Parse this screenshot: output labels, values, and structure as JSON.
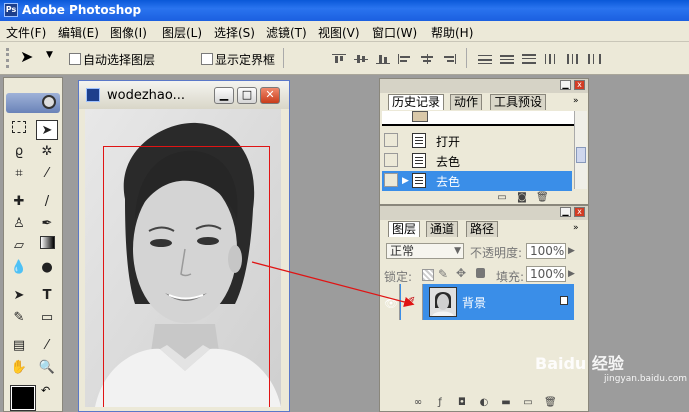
{
  "app": {
    "title": "Adobe Photoshop"
  },
  "menu": [
    "文件(F)",
    "编辑(E)",
    "图像(I)",
    "图层(L)",
    "选择(S)",
    "滤镜(T)",
    "视图(V)",
    "窗口(W)",
    "帮助(H)"
  ],
  "options": {
    "auto_select_label": "自动选择图层",
    "show_bounds_label": "显示定界框"
  },
  "document": {
    "title": "wodezhao..."
  },
  "history_panel": {
    "tabs": [
      "历史记录",
      "动作",
      "工具预设"
    ],
    "items": [
      {
        "label": "打开",
        "selected": false
      },
      {
        "label": "去色",
        "selected": false
      },
      {
        "label": "去色",
        "selected": true
      }
    ]
  },
  "layers_panel": {
    "tabs": [
      "图层",
      "通道",
      "路径"
    ],
    "blend_mode": "正常",
    "opacity_label": "不透明度:",
    "opacity_value": "100%",
    "lock_label": "锁定:",
    "fill_label": "填充:",
    "fill_value": "100%",
    "layer_name": "背景"
  },
  "watermark": {
    "text": "Baidu 经验",
    "sub": "jingyan.baidu.com"
  },
  "colors": {
    "titlebar": "#1b5fe0",
    "selection": "#3a8ee8",
    "annotation": "#e01414"
  }
}
